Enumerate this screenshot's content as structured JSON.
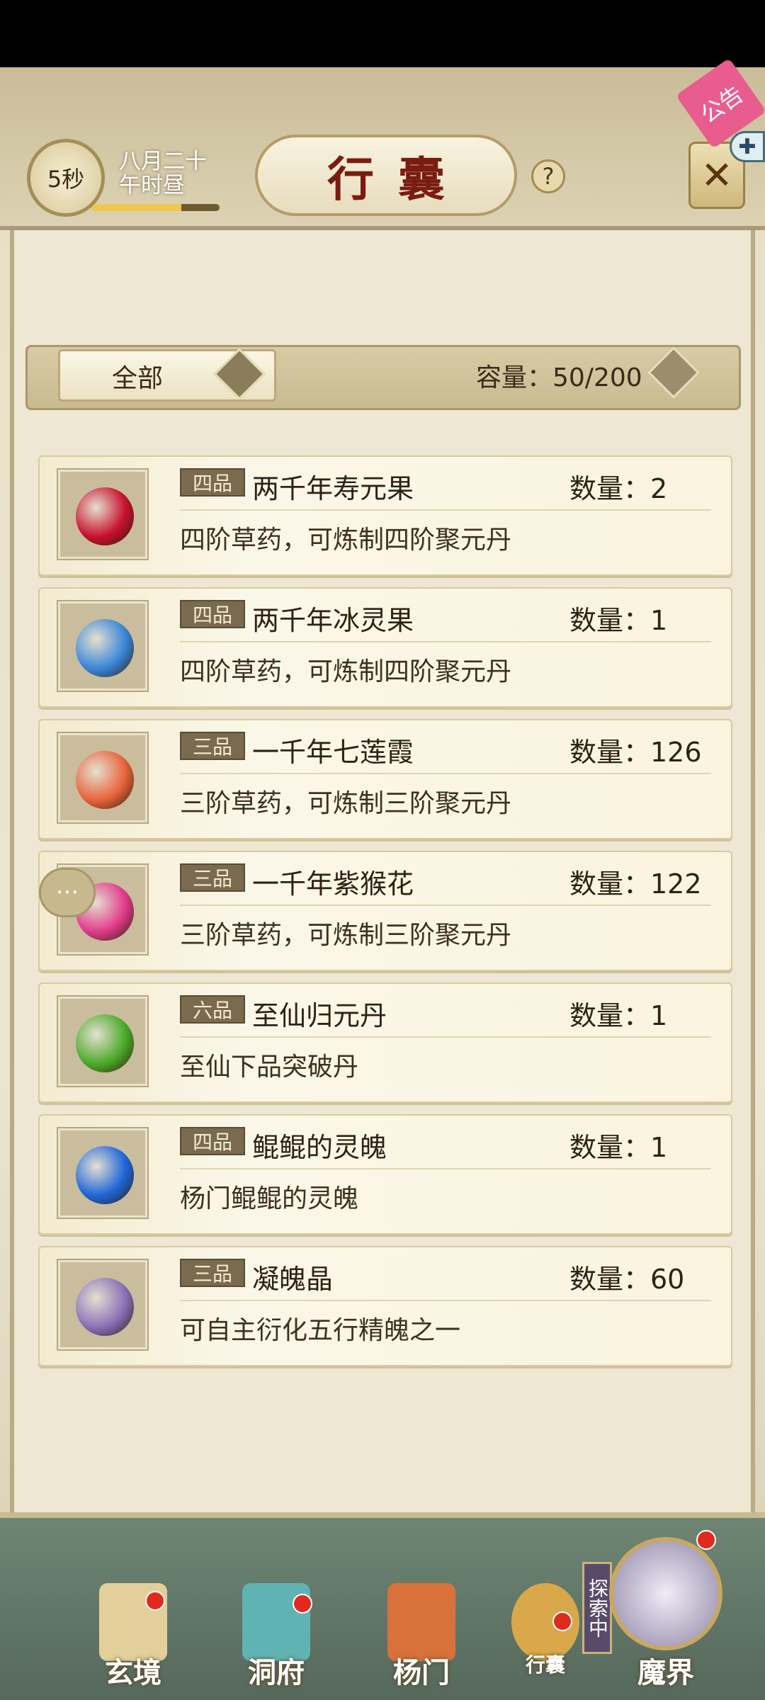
{
  "header": {
    "timer": "5秒",
    "date_line1": "八月二十",
    "date_line2": "午时昼",
    "title": "行囊",
    "help": "?",
    "notice": "公告",
    "time_progress": 0.7
  },
  "filter": {
    "label": "全部",
    "capacity": "容量：50/200"
  },
  "items": [
    {
      "grade": "四品",
      "name": "两千年寿元果",
      "qty": "数量：2",
      "desc": "四阶草药，可炼制四阶聚元丹",
      "color": "#c8102e"
    },
    {
      "grade": "四品",
      "name": "两千年冰灵果",
      "qty": "数量：1",
      "desc": "四阶草药，可炼制四阶聚元丹",
      "color": "#3a86d8"
    },
    {
      "grade": "三品",
      "name": "一千年七莲霞",
      "qty": "数量：126",
      "desc": "三阶草药，可炼制三阶聚元丹",
      "color": "#e8633a"
    },
    {
      "grade": "三品",
      "name": "一千年紫猴花",
      "qty": "数量：122",
      "desc": "三阶草药，可炼制三阶聚元丹",
      "color": "#e03a8a"
    },
    {
      "grade": "六品",
      "name": "至仙归元丹",
      "qty": "数量：1",
      "desc": "至仙下品突破丹",
      "color": "#4caa2a"
    },
    {
      "grade": "四品",
      "name": "鲲鲲的灵魄",
      "qty": "数量：1",
      "desc": "杨门鲲鲲的灵魄",
      "color": "#1e66d8"
    },
    {
      "grade": "三品",
      "name": "凝魄晶",
      "qty": "数量：60",
      "desc": "可自主衍化五行精魄之一",
      "color": "#8a70b8"
    }
  ],
  "nav": {
    "xuanjing": "玄境",
    "dongfu": "洞府",
    "yangmen": "杨门",
    "xingnang": "行囊",
    "mojie": "魔界",
    "explore": "探索中"
  }
}
